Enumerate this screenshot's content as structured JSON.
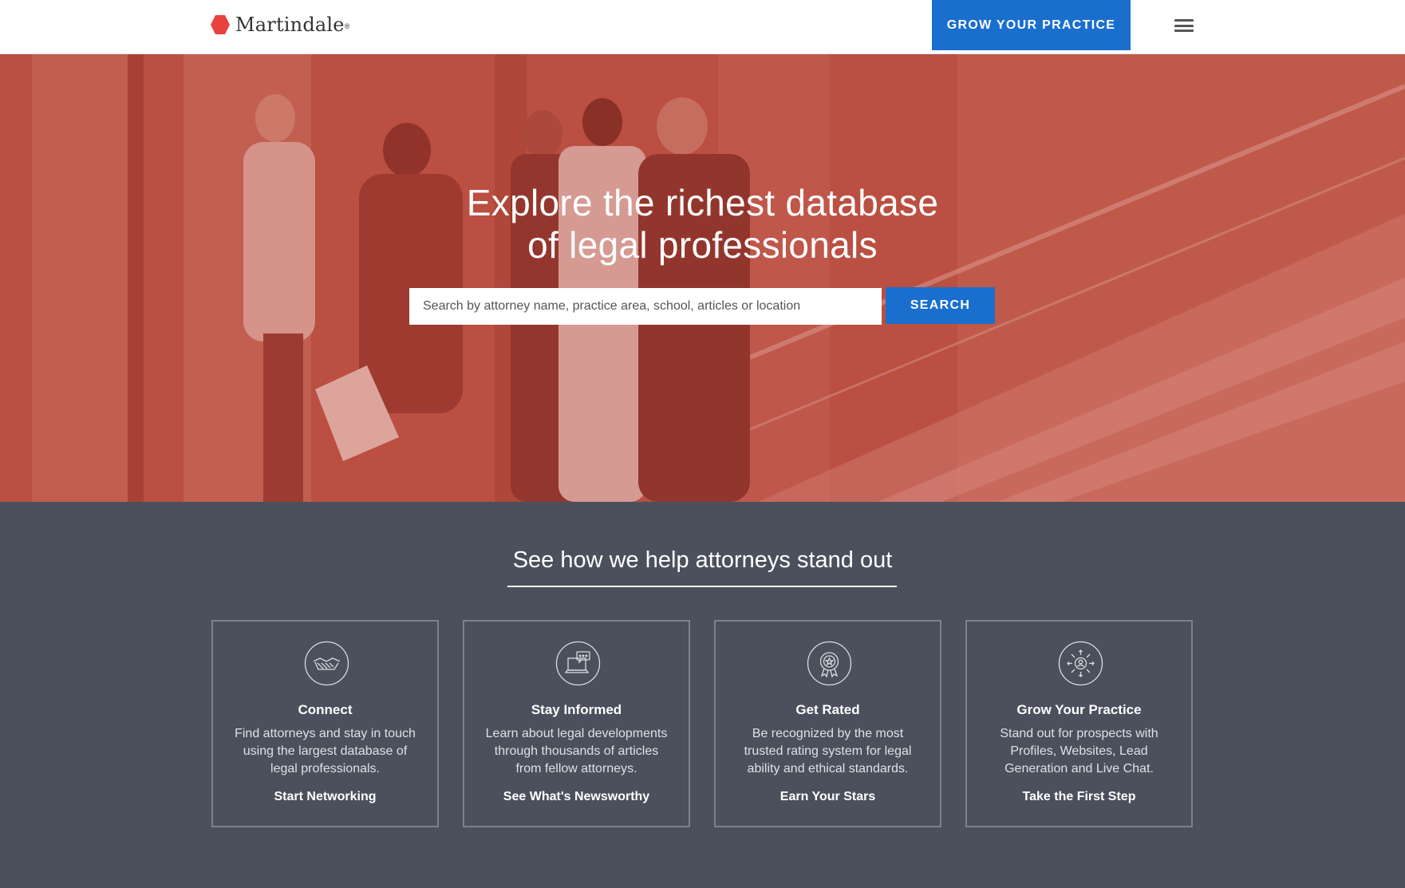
{
  "header": {
    "logo_text": "Martindale",
    "logo_tm": "®",
    "grow_button": "GROW YOUR PRACTICE",
    "menu_icon": "hamburger-menu-icon"
  },
  "hero": {
    "title_line1": "Explore the richest database",
    "title_line2": "of legal professionals",
    "search_placeholder": "Search by attorney name, practice area, school, articles or location",
    "search_button": "SEARCH"
  },
  "section": {
    "title": "See how we help attorneys stand out"
  },
  "cards": [
    {
      "icon": "handshake-icon",
      "title": "Connect",
      "desc": "Find attorneys and stay in touch using the largest database of legal professionals.",
      "link": "Start Networking"
    },
    {
      "icon": "laptop-chat-icon",
      "title": "Stay Informed",
      "desc": "Learn about legal developments through thousands of articles from fellow attorneys.",
      "link": "See What's Newsworthy"
    },
    {
      "icon": "award-badge-icon",
      "title": "Get Rated",
      "desc": "Be recognized by the most trusted rating system for legal ability and ethical standards.",
      "link": "Earn Your Stars"
    },
    {
      "icon": "network-growth-icon",
      "title": "Grow Your Practice",
      "desc": "Stand out for prospects with Profiles, Websites, Lead Generation and Live Chat.",
      "link": "Take the First Step"
    }
  ],
  "colors": {
    "brand_red": "#e8423f",
    "accent_blue": "#1a6fce",
    "section_bg": "#4a505c"
  }
}
